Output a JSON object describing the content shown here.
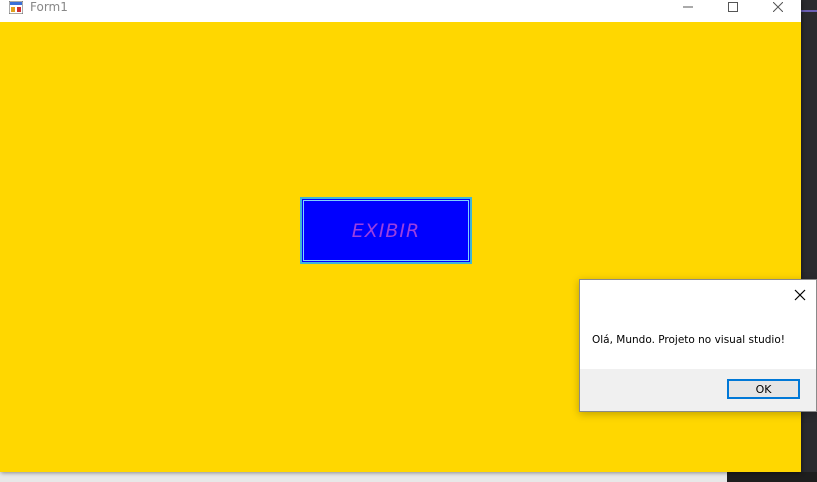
{
  "window": {
    "title": "Form1",
    "background_color": "#ffd700",
    "controls": {
      "minimize_icon": "minimize-icon",
      "maximize_icon": "maximize-icon",
      "close_icon": "close-icon"
    }
  },
  "form": {
    "exibir_button_label": "EXIBIR",
    "exibir_button_bg": "#0000ff",
    "exibir_button_text_color": "#9a3fe0"
  },
  "message_box": {
    "message": "Olá, Mundo. Projeto no visual studio!",
    "ok_label": "OK",
    "close_icon": "close-icon"
  }
}
